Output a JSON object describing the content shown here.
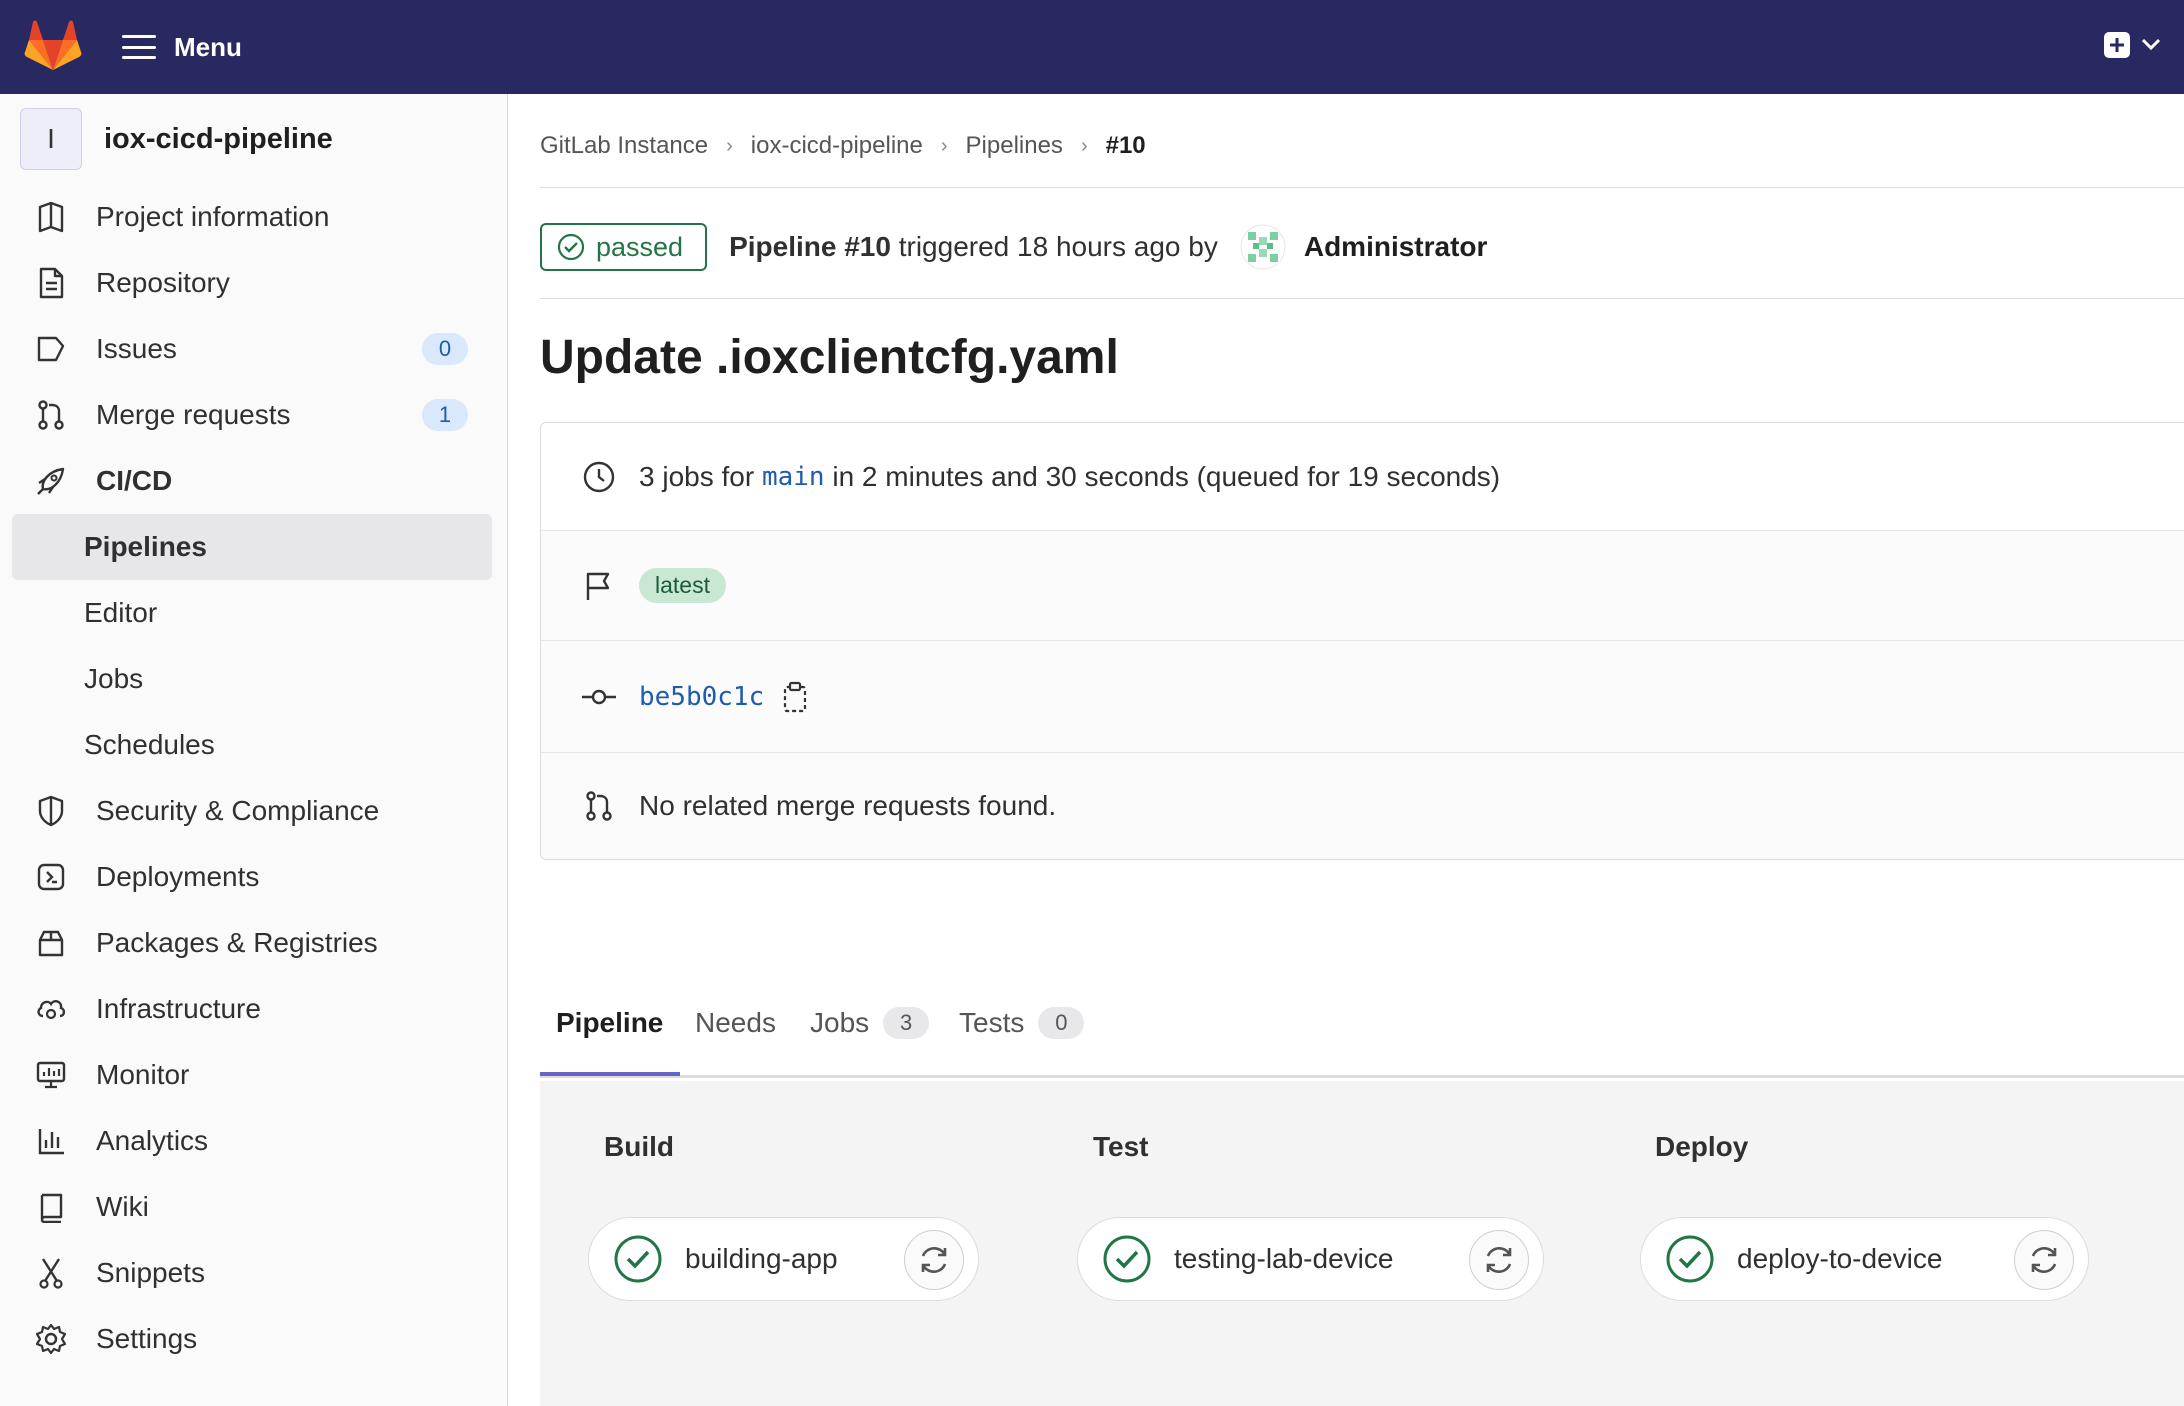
{
  "topbar": {
    "menu_label": "Menu"
  },
  "project": {
    "avatar_letter": "I",
    "name": "iox-cicd-pipeline"
  },
  "sidebar": {
    "items": [
      {
        "label": "Project information",
        "icon": "project-icon"
      },
      {
        "label": "Repository",
        "icon": "document-icon"
      },
      {
        "label": "Issues",
        "icon": "issues-icon",
        "badge": "0"
      },
      {
        "label": "Merge requests",
        "icon": "merge-request-icon",
        "badge": "1"
      },
      {
        "label": "CI/CD",
        "icon": "rocket-icon"
      },
      {
        "label": "Pipelines",
        "sub": true,
        "active": true
      },
      {
        "label": "Editor",
        "sub": true
      },
      {
        "label": "Jobs",
        "sub": true
      },
      {
        "label": "Schedules",
        "sub": true
      },
      {
        "label": "Security & Compliance",
        "icon": "shield-icon"
      },
      {
        "label": "Deployments",
        "icon": "deployments-icon"
      },
      {
        "label": "Packages & Registries",
        "icon": "package-icon"
      },
      {
        "label": "Infrastructure",
        "icon": "cloud-gear-icon"
      },
      {
        "label": "Monitor",
        "icon": "monitor-icon"
      },
      {
        "label": "Analytics",
        "icon": "chart-icon"
      },
      {
        "label": "Wiki",
        "icon": "book-icon"
      },
      {
        "label": "Snippets",
        "icon": "scissors-icon"
      },
      {
        "label": "Settings",
        "icon": "gear-icon"
      }
    ]
  },
  "breadcrumb": [
    "GitLab Instance",
    "iox-cicd-pipeline",
    "Pipelines",
    "#10"
  ],
  "status": {
    "badge": "passed",
    "pipeline": "Pipeline #10",
    "triggered": "triggered 18 hours ago by",
    "user": "Administrator"
  },
  "title": "Update .ioxclientcfg.yaml",
  "info": {
    "jobs_prefix": "3 jobs for",
    "branch": "main",
    "jobs_suffix": "in 2 minutes and 30 seconds (queued for 19 seconds)",
    "tag": "latest",
    "commit": "be5b0c1c",
    "mr_text": "No related merge requests found."
  },
  "tabs": [
    {
      "label": "Pipeline"
    },
    {
      "label": "Needs"
    },
    {
      "label": "Jobs",
      "count": "3"
    },
    {
      "label": "Tests",
      "count": "0"
    }
  ],
  "stages": [
    {
      "name": "Build",
      "job": "building-app"
    },
    {
      "name": "Test",
      "job": "testing-lab-device"
    },
    {
      "name": "Deploy",
      "job": "deploy-to-device"
    }
  ],
  "colors": {
    "topbar": "#292961",
    "success": "#217645",
    "link": "#1f5bb0",
    "tab_active": "#6666c4"
  }
}
